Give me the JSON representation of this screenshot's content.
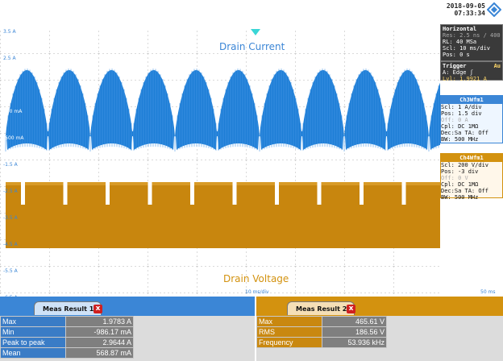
{
  "datetime": {
    "date": "2018-09-05",
    "time": "07:33:34"
  },
  "logo_icon": "rohde-schwarz-diamond-icon",
  "waveform": {
    "upper_label": "Drain Current",
    "lower_label": "Drain Voltage",
    "timebase_label": "10 ms/div",
    "right_time_label": "50 ms",
    "y_labels": [
      "3.5 A",
      "2.5 A",
      "1.5 A",
      "500 mA",
      "-500 mA",
      "-1.5 A",
      "-2.5 A",
      "-3.5 A",
      "-4.5 A",
      "-5.5 A",
      "-6.5 A"
    ],
    "current_color": "#1e7ed6",
    "voltage_color": "#c8860e",
    "marker_color": "#3ad6d6"
  },
  "horizontal": {
    "title": "Horizontal",
    "rows": [
      "Res: 2.5 ns / 400 MSa",
      "RL: 40 MSa",
      "Scl: 10 ms/div",
      "Pos: 0 s"
    ]
  },
  "trigger": {
    "title": "Trigger",
    "mode": "Au",
    "rows": [
      "A:  Edge  ʃ"
    ],
    "level": "Lvl: 1.9921 A"
  },
  "ch3": {
    "title": "Ch3Wfm1",
    "rows": [
      "Scl: 1 A/div",
      "Pos: 1.5 div",
      "Off: 0 A",
      "Cpl: DC 1MΩ",
      "Dec:Sa    TA: Off",
      "BW: 500 MHz"
    ]
  },
  "ch4": {
    "title": "Ch4Wfm1",
    "rows": [
      "Scl: 200 V/div",
      "Pos: -3 div",
      "Off: 0 V",
      "Cpl: DC 1MΩ",
      "Dec:Sa    TA: Off",
      "BW: 500 MHz"
    ]
  },
  "meas1": {
    "tab": "Meas Result 1",
    "close": "x",
    "rows": [
      {
        "label": "Max",
        "value": "1.9783 A"
      },
      {
        "label": "Min",
        "value": "-986.17 mA"
      },
      {
        "label": "Peak to peak",
        "value": "2.9644 A"
      },
      {
        "label": "Mean",
        "value": "568.87 mA"
      }
    ]
  },
  "meas2": {
    "tab": "Meas Result 2",
    "close": "x",
    "rows": [
      {
        "label": "Max",
        "value": "465.61 V"
      },
      {
        "label": "RMS",
        "value": "186.56 V"
      },
      {
        "label": "Frequency",
        "value": "53.936 kHz"
      }
    ]
  }
}
